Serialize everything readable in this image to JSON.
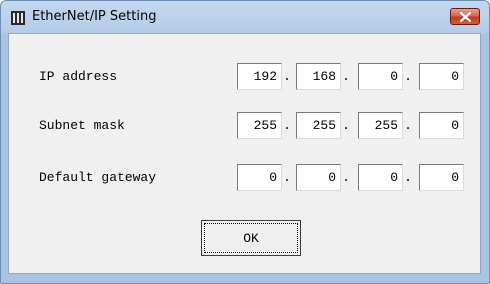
{
  "window": {
    "title": "EtherNet/IP Setting"
  },
  "rows": [
    {
      "label": "IP address",
      "octets": [
        "192",
        "168",
        "0",
        "0"
      ]
    },
    {
      "label": "Subnet mask",
      "octets": [
        "255",
        "255",
        "255",
        "0"
      ]
    },
    {
      "label": "Default gateway",
      "octets": [
        "0",
        "0",
        "0",
        "0"
      ]
    }
  ],
  "separator": ".",
  "buttons": {
    "ok_label": "OK"
  },
  "icons": {
    "app": "app-icon",
    "close": "close-icon"
  },
  "colors": {
    "titlebar": "#b6cde9",
    "close": "#c13a20",
    "client": "#f0f0f0"
  }
}
